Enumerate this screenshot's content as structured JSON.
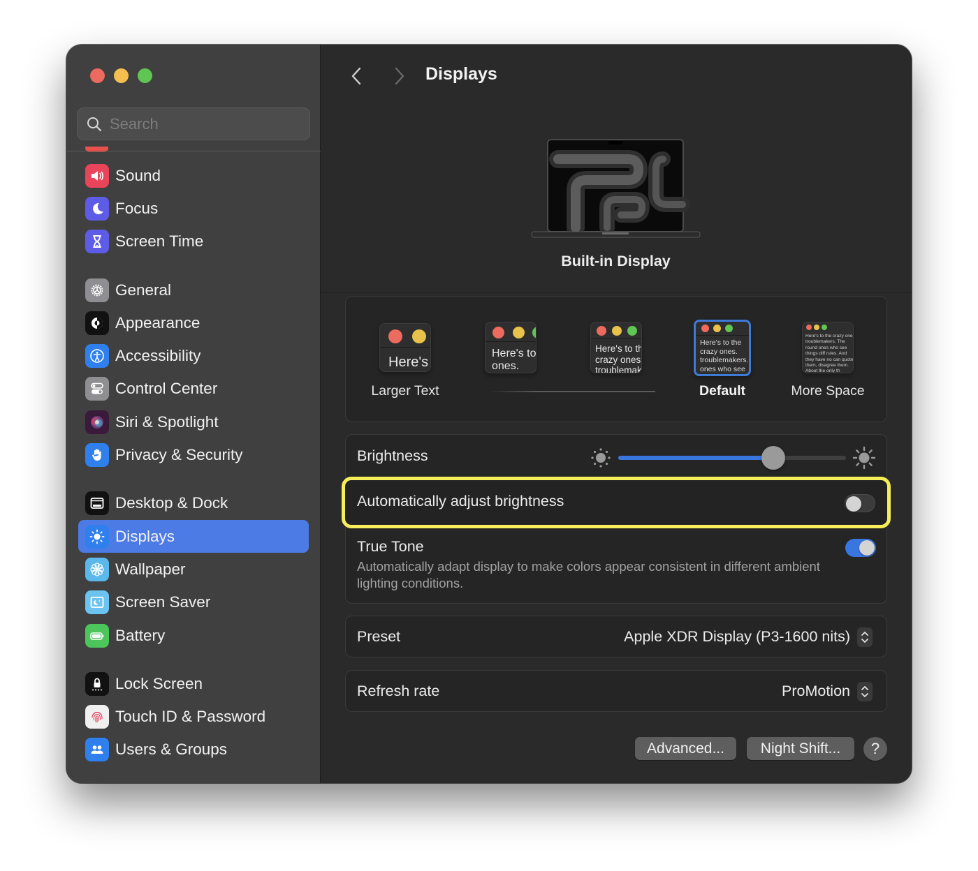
{
  "window": {
    "title": "Displays",
    "traffic_lights": [
      "close",
      "minimize",
      "zoom"
    ]
  },
  "sidebar": {
    "search": {
      "placeholder": "Search",
      "value": ""
    },
    "groups": [
      [
        {
          "label": "Sound",
          "icon": "speaker-icon",
          "color": "#e8445a"
        },
        {
          "label": "Focus",
          "icon": "moon-icon",
          "color": "#5e5ce6"
        },
        {
          "label": "Screen Time",
          "icon": "hourglass-icon",
          "color": "#5e5ce6"
        }
      ],
      [
        {
          "label": "General",
          "icon": "gear-icon",
          "color": "#8e8e93"
        },
        {
          "label": "Appearance",
          "icon": "appearance-icon",
          "color": "#111111"
        },
        {
          "label": "Accessibility",
          "icon": "accessibility-icon",
          "color": "#2f80ed"
        },
        {
          "label": "Control Center",
          "icon": "toggles-icon",
          "color": "#8e8e93"
        },
        {
          "label": "Siri & Spotlight",
          "icon": "siri-icon",
          "color": "#3a1a3a"
        },
        {
          "label": "Privacy & Security",
          "icon": "hand-icon",
          "color": "#2f80ed"
        }
      ],
      [
        {
          "label": "Desktop & Dock",
          "icon": "dock-icon",
          "color": "#111111"
        },
        {
          "label": "Displays",
          "icon": "sun-icon",
          "color": "#2f80ed",
          "active": true
        },
        {
          "label": "Wallpaper",
          "icon": "flower-icon",
          "color": "#5ab8ea"
        },
        {
          "label": "Screen Saver",
          "icon": "screensaver-icon",
          "color": "#6cc3ef"
        },
        {
          "label": "Battery",
          "icon": "battery-icon",
          "color": "#4cc55a"
        }
      ],
      [
        {
          "label": "Lock Screen",
          "icon": "lock-icon",
          "color": "#111111"
        },
        {
          "label": "Touch ID & Password",
          "icon": "fingerprint-icon",
          "color": "#f0f0f0"
        },
        {
          "label": "Users & Groups",
          "icon": "users-icon",
          "color": "#2f80ed"
        }
      ]
    ]
  },
  "main": {
    "title": "Displays",
    "display_name": "Built-in Display",
    "resolution": {
      "options": [
        {
          "label": "Larger Text",
          "preview": "Here's",
          "selected": false
        },
        {
          "label": "",
          "preview": "Here's to the crazy ones. troublemakers.",
          "selected": false
        },
        {
          "label": "",
          "preview": "Here's to the crazy ones, troublemakers, ones who",
          "selected": false
        },
        {
          "label": "Default",
          "preview": "Here's to the crazy ones. troublemakers. ones who see things rules. And they",
          "selected": true
        },
        {
          "label": "More Space",
          "preview": "Here's to the crazy ones troublemakers. The round ones who see things diff rules. And they have no can quote them, disagree them. About the only th Because they change th",
          "selected": false
        }
      ]
    },
    "brightness": {
      "label": "Brightness",
      "value_percent": 68
    },
    "auto_brightness": {
      "label": "Automatically adjust brightness",
      "enabled": false
    },
    "true_tone": {
      "label": "True Tone",
      "description": "Automatically adapt display to make colors appear consistent in different ambient lighting conditions.",
      "enabled": true
    },
    "preset": {
      "label": "Preset",
      "value": "Apple XDR Display (P3-1600 nits)"
    },
    "refresh_rate": {
      "label": "Refresh rate",
      "value": "ProMotion"
    },
    "buttons": {
      "advanced": "Advanced...",
      "night_shift": "Night Shift...",
      "help": "?"
    },
    "colors": {
      "accent": "#3a76e0",
      "highlight": "#f5ee5a"
    }
  }
}
